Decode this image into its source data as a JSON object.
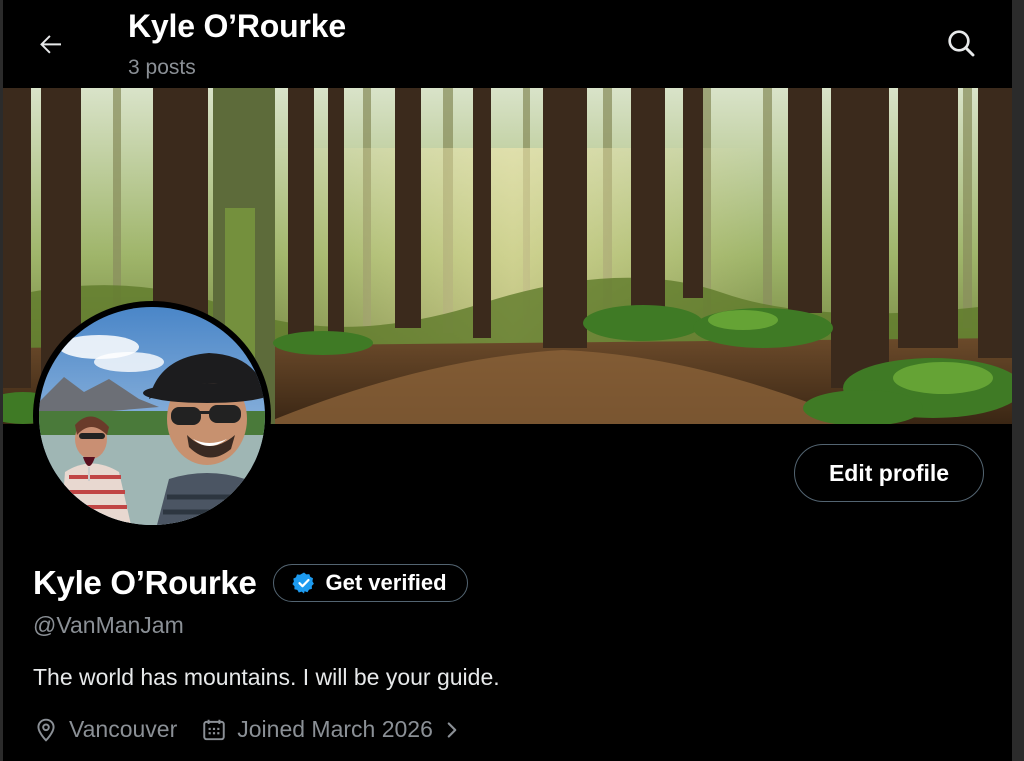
{
  "header": {
    "title": "Kyle O’Rourke",
    "subtitle": "3 posts",
    "back_icon": "arrow-left-icon",
    "search_icon": "search-icon"
  },
  "profile": {
    "display_name": "Kyle O’Rourke",
    "handle": "@VanManJam",
    "bio": "The world has mountains. I will be your guide.",
    "location": "Vancouver",
    "joined": "Joined March 2026",
    "edit_label": "Edit profile",
    "verify_label": "Get verified",
    "verify_icon": "verified-badge-icon",
    "location_icon": "map-pin-icon",
    "calendar_icon": "calendar-icon",
    "joined_chevron": "chevron-right-icon"
  },
  "colors": {
    "background": "#000000",
    "text_primary": "#e7e9ea",
    "text_secondary": "#8b9096",
    "verified_blue": "#1d9bf0",
    "border": "#536471"
  }
}
